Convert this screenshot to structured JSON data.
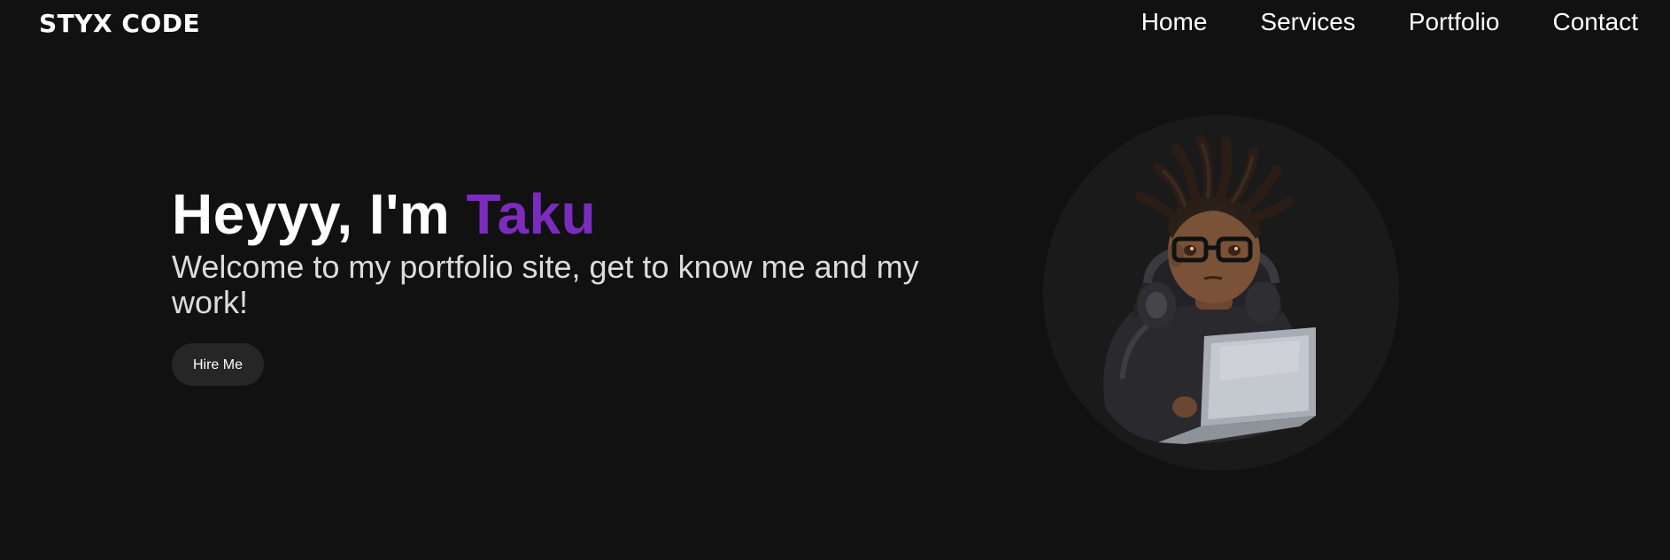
{
  "header": {
    "logo": "STYX CODE",
    "nav": [
      "Home",
      "Services",
      "Portfolio",
      "Contact"
    ]
  },
  "hero": {
    "greeting": "Heyyy, I'm ",
    "name": "Taku",
    "subtitle": "Welcome to my portfolio site, get to know me and my work!",
    "cta": "Hire Me"
  },
  "colors": {
    "background": "#111111",
    "accent": "#7b2cbf",
    "button": "#262626",
    "avatar_circle": "#1a1a1a"
  },
  "icons": {
    "avatar": "coder-avatar-illustration"
  }
}
